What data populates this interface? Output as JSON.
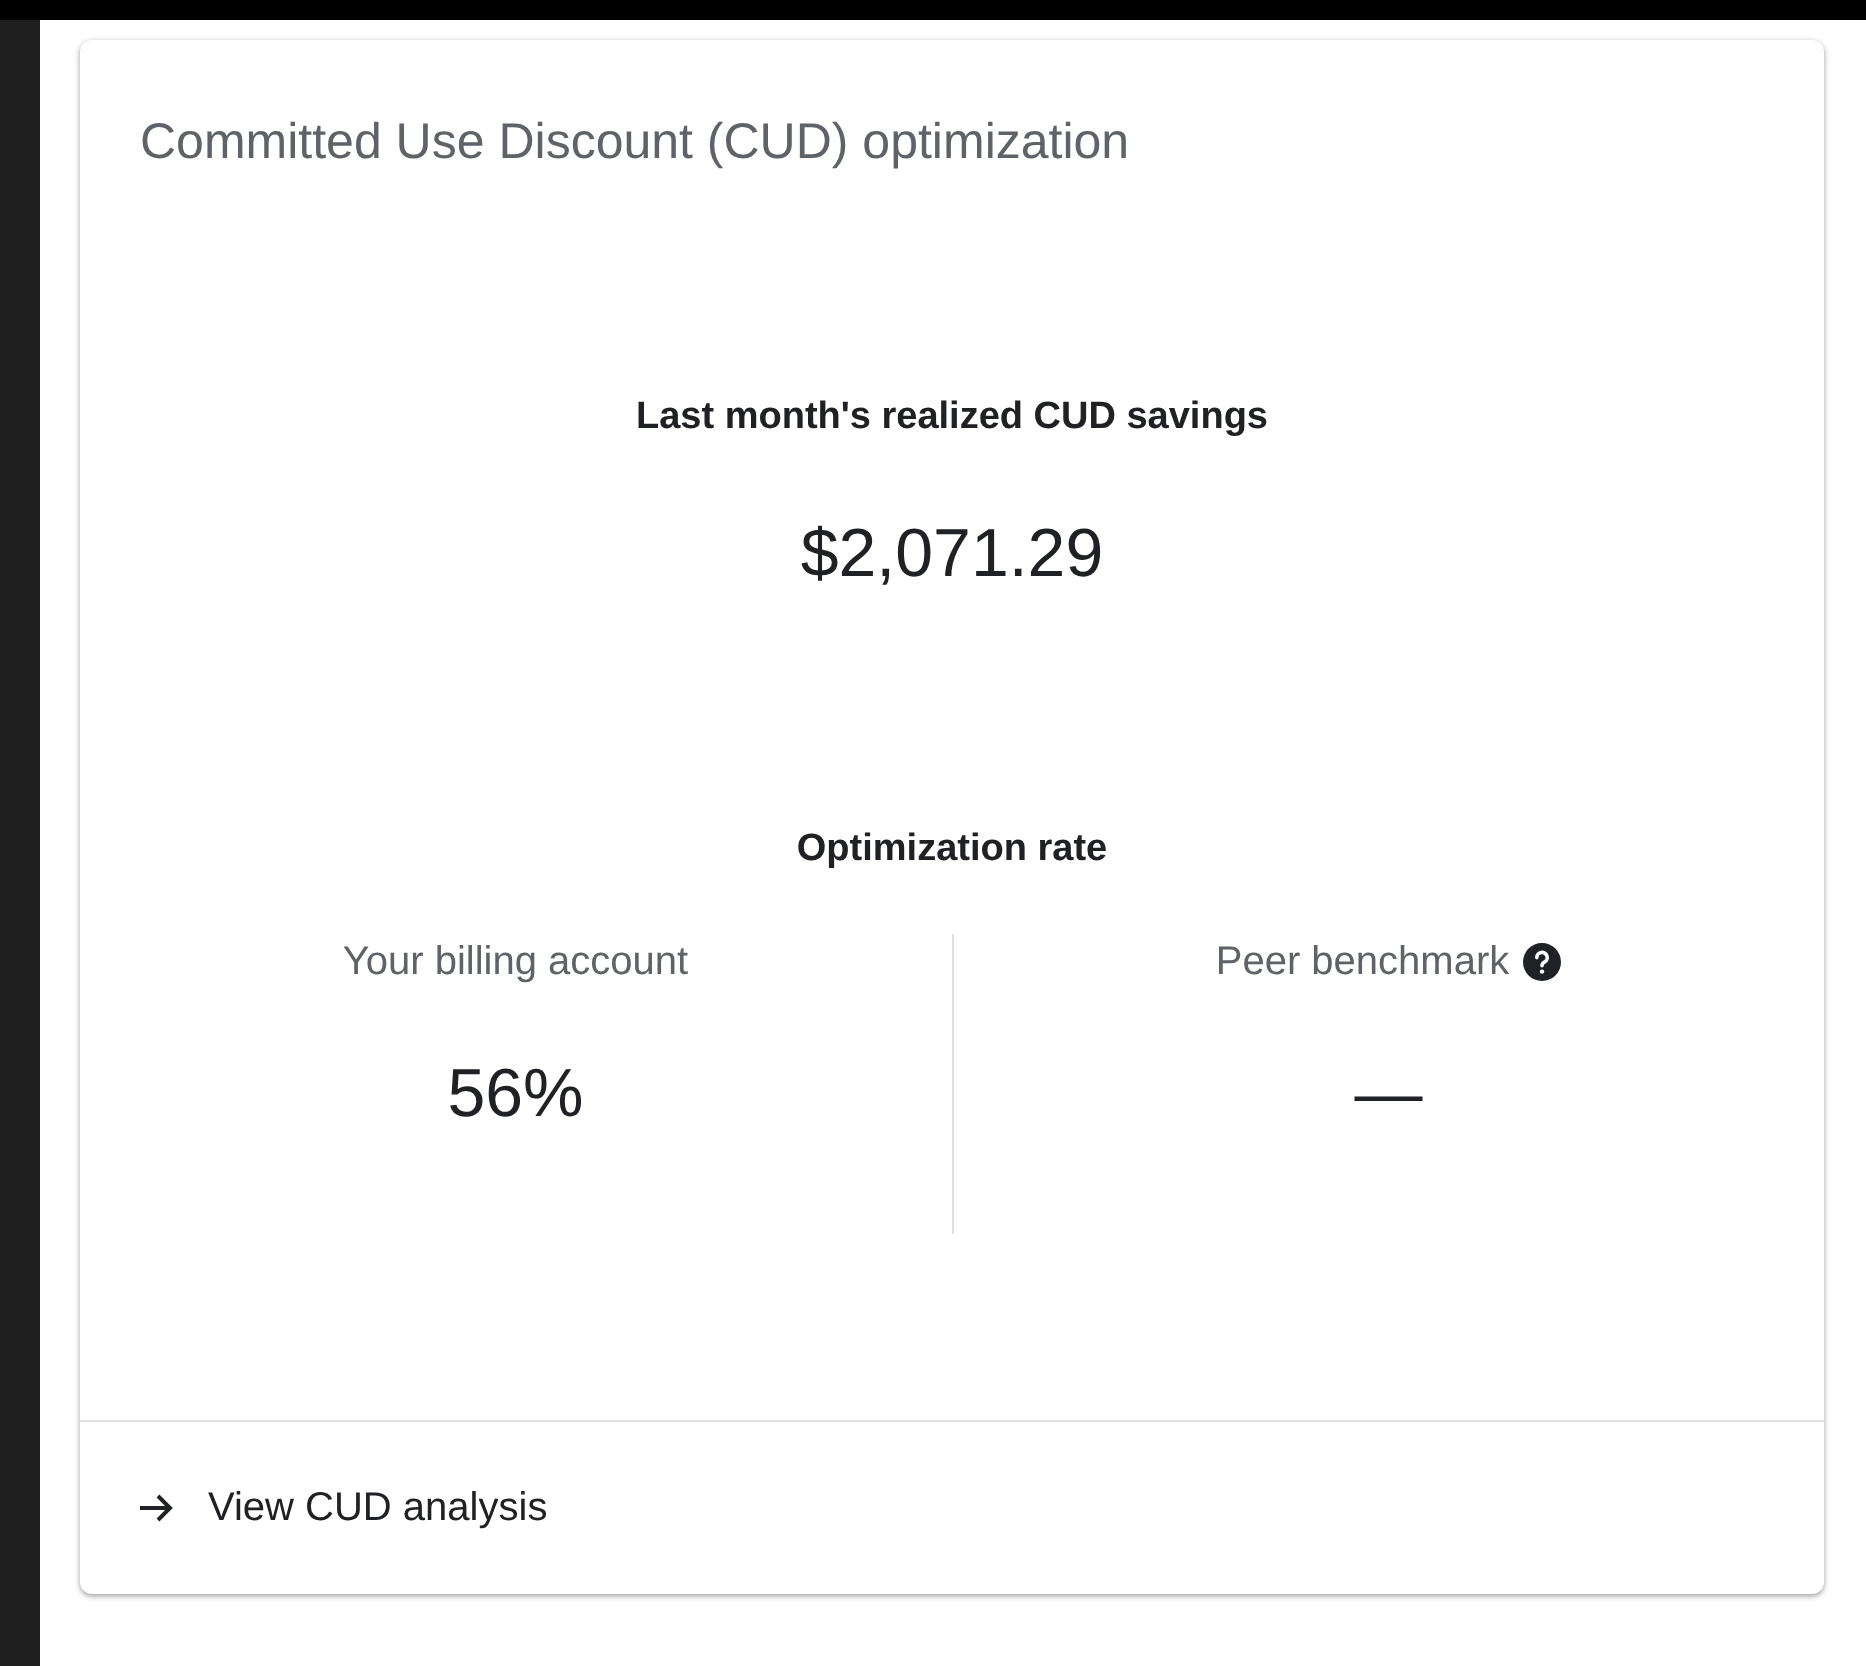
{
  "card": {
    "title": "Committed Use Discount (CUD) optimization",
    "savings": {
      "label": "Last month's realized CUD savings",
      "value": "$2,071.29"
    },
    "rate": {
      "label": "Optimization rate",
      "columns": [
        {
          "label": "Your billing account",
          "value": "56%",
          "help": false
        },
        {
          "label": "Peer benchmark",
          "value": "—",
          "help": true
        }
      ]
    },
    "link": {
      "label": "View CUD analysis"
    }
  }
}
